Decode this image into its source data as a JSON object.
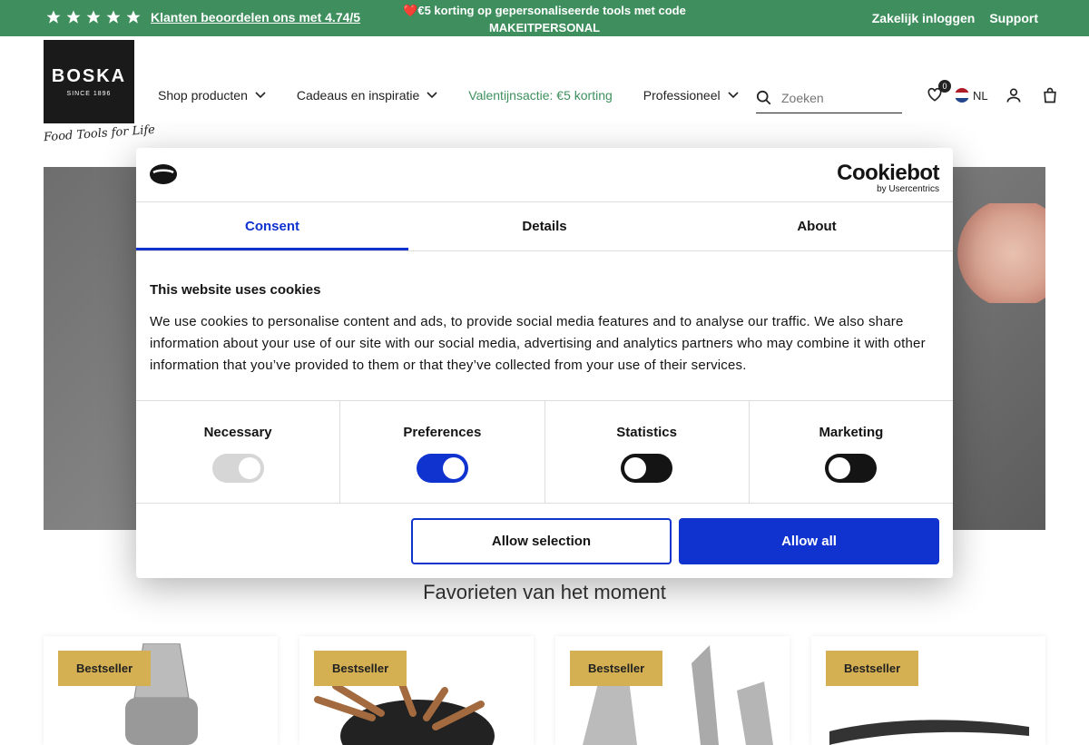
{
  "topbar": {
    "rating_text": "Klanten beoordelen ons met 4.74/5",
    "stars": 5,
    "promo_line1": "❤️€5 korting op gepersonaliseerde tools met code",
    "promo_line2": "MAKEITPERSONAL",
    "business_login": "Zakelijk inloggen",
    "support": "Support",
    "bg_color": "#3f8f5e"
  },
  "header": {
    "logo_brand": "BOSKA",
    "logo_since": "SINCE 1896",
    "tagline": "Food Tools for Life",
    "nav": [
      {
        "label": "Shop producten"
      },
      {
        "label": "Cadeaus en inspiratie"
      },
      {
        "label": "Valentijnsactie: €5 korting"
      },
      {
        "label": "Professioneel"
      }
    ],
    "search_placeholder": "Zoeken",
    "wishlist_count": "0",
    "language": "NL"
  },
  "main": {
    "section_title": "Favorieten van het moment",
    "cards": [
      {
        "badge": "Bestseller"
      },
      {
        "badge": "Bestseller"
      },
      {
        "badge": "Bestseller"
      },
      {
        "badge": "Bestseller"
      }
    ]
  },
  "cookie": {
    "brand": "Cookiebot",
    "brand_sub": "by Usercentrics",
    "tabs": [
      {
        "label": "Consent",
        "active": true
      },
      {
        "label": "Details"
      },
      {
        "label": "About"
      }
    ],
    "heading": "This website uses cookies",
    "body": "We use cookies to personalise content and ads, to provide social media features and to analyse our traffic. We also share information about your use of our site with our social media, advertising and analytics partners who may combine it with other information that you’ve provided to them or that they’ve collected from your use of their services.",
    "toggles": [
      {
        "label": "Necessary",
        "state": "disabled-on"
      },
      {
        "label": "Preferences",
        "state": "on"
      },
      {
        "label": "Statistics",
        "state": "off"
      },
      {
        "label": "Marketing",
        "state": "off"
      }
    ],
    "allow_selection": "Allow selection",
    "allow_all": "Allow all",
    "accent_color": "#1032cf"
  }
}
